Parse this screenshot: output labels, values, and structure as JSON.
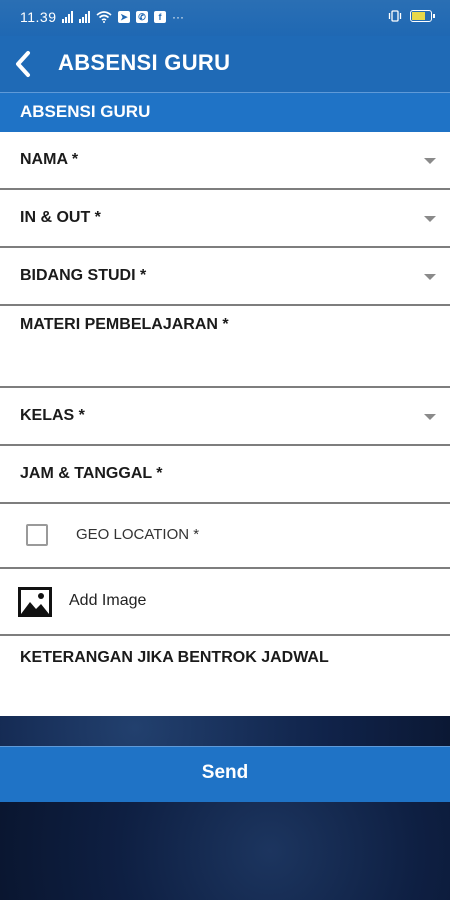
{
  "status_bar": {
    "time": "11.39",
    "ellipsis": "···",
    "notification_icons": [
      "telegram-icon",
      "whatsapp-icon",
      "facebook-icon"
    ],
    "battery_color": "#e7d84a"
  },
  "app_bar": {
    "title": "ABSENSI GURU"
  },
  "section_header": {
    "title": "ABSENSI GURU"
  },
  "form": {
    "nama": "NAMA *",
    "in_out": "IN & OUT *",
    "bidang_studi": "BIDANG STUDI *",
    "materi": "MATERI PEMBELAJARAN *",
    "kelas": "KELAS *",
    "jam_tanggal": "JAM & TANGGAL *",
    "geo_location": "GEO LOCATION *",
    "add_image": "Add Image",
    "keterangan": "KETERANGAN JIKA BENTROK JADWAL"
  },
  "send_button": {
    "label": "Send"
  },
  "colors": {
    "primary": "#1f6ab6",
    "accent": "#1f73c6",
    "background": "#0d1b33"
  }
}
